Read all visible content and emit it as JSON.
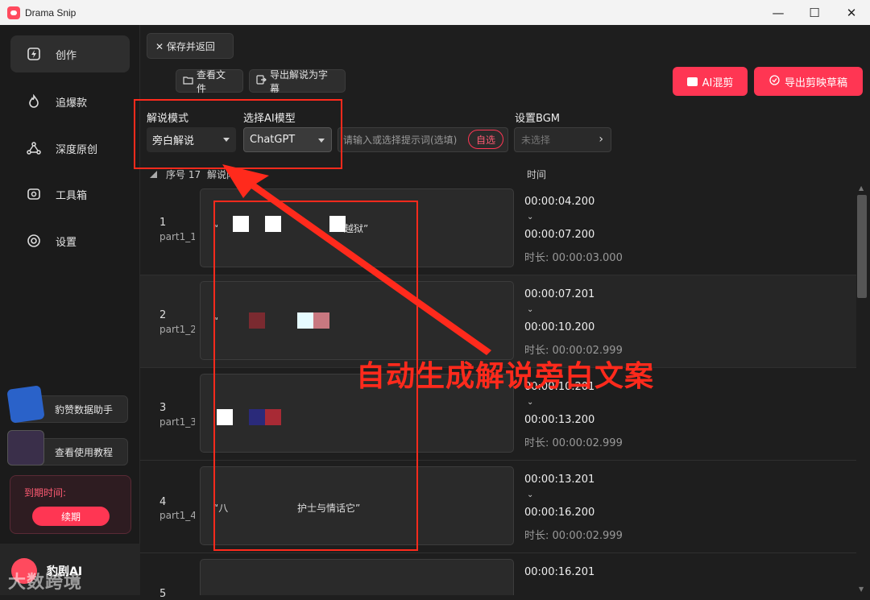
{
  "window": {
    "title": "Drama Snip",
    "minimize": "—",
    "maximize": "☐",
    "close": "✕"
  },
  "sidebar": {
    "items": [
      {
        "label": "创作",
        "icon": "lightning-icon"
      },
      {
        "label": "追爆款",
        "icon": "flame-icon"
      },
      {
        "label": "深度原创",
        "icon": "network-icon"
      },
      {
        "label": "工具箱",
        "icon": "toolbox-icon"
      },
      {
        "label": "设置",
        "icon": "gear-icon"
      }
    ],
    "helper_button": "豹赞数据助手",
    "tutorial_button": "查看使用教程",
    "expire_label": "到期时间: ",
    "renew_button": "续期",
    "brand_name": "豹剧AI",
    "watermark": "大数跨境"
  },
  "toolbar": {
    "save_return": "✕ 保存并返回",
    "view_files": "查看文件",
    "export_subtitles": "导出解说为字幕",
    "ai_mix": "AI混剪",
    "export_draft": "导出剪映草稿"
  },
  "settings": {
    "mode_label": "解说模式",
    "mode_value": "旁白解说",
    "model_label": "选择AI模型",
    "model_value": "ChatGPT",
    "prompt_placeholder": "请输入或选择提示词(选填)",
    "pick_button": "自选",
    "bgm_label": "设置BGM",
    "bgm_value": "未选择"
  },
  "table": {
    "col_index": "序号 17",
    "col_content": "解说内容",
    "col_time": "时间",
    "rows": [
      {
        "num": "1",
        "part": "part1_1",
        "text": "“",
        "text_tail": "越狱”",
        "start": "00:00:04.200",
        "end": "00:00:07.200",
        "duration": "时长: 00:00:03.000"
      },
      {
        "num": "2",
        "part": "part1_2",
        "text": "“",
        "text_tail": "",
        "start": "00:00:07.201",
        "end": "00:00:10.200",
        "duration": "时长: 00:00:02.999"
      },
      {
        "num": "3",
        "part": "part1_3",
        "text": "",
        "text_tail": "",
        "start": "00:00:10.201",
        "end": "00:00:13.200",
        "duration": "时长: 00:00:02.999"
      },
      {
        "num": "4",
        "part": "part1_4",
        "text": "“八",
        "text_tail": "护士与情话它”",
        "start": "00:00:13.201",
        "end": "00:00:16.200",
        "duration": "时长: 00:00:02.999"
      },
      {
        "num": "5",
        "part": "",
        "text": "",
        "text_tail": "",
        "start": "00:00:16.201",
        "end": "",
        "duration": ""
      }
    ]
  },
  "annotation": {
    "text": "自动生成解说旁白文案",
    "color": "#ff2a1c"
  },
  "colors": {
    "accent": "#ff3653",
    "background": "#1e1e1e",
    "annotation_red": "#ff2a1c"
  }
}
